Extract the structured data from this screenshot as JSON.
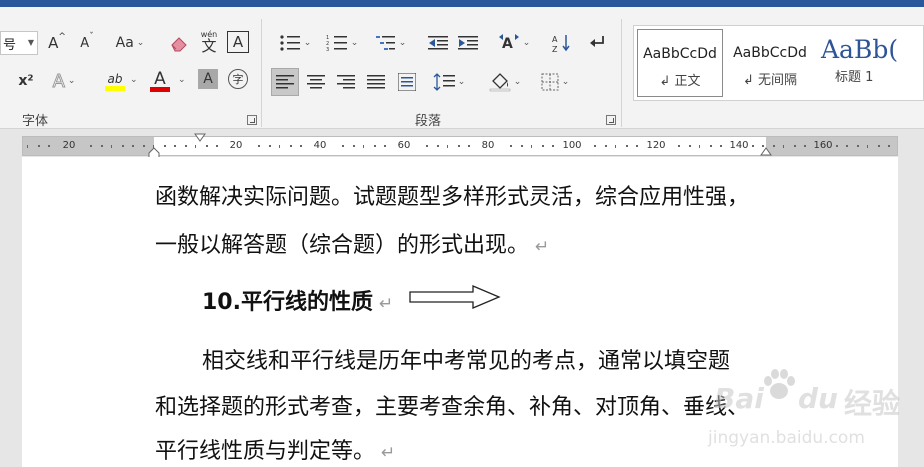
{
  "ribbon": {
    "font_group": {
      "label": "字体",
      "font_size_value": "号",
      "grow_font": "A",
      "shrink_font": "A",
      "change_case": "Aa",
      "phonetic_guide": "wén",
      "phonetic_char": "文",
      "char_border": "A",
      "superscript": "x²",
      "text_effects": "A",
      "highlight": "ab",
      "font_color": "A",
      "char_shading": "A",
      "enclose_char": "字"
    },
    "paragraph_group": {
      "label": "段落"
    },
    "styles_group": {
      "items": [
        {
          "sample": "AaBbCcDd",
          "name": "↲ 正文"
        },
        {
          "sample": "AaBbCcDd",
          "name": "↲ 无间隔"
        },
        {
          "sample": "AaBb(",
          "name": "标题 1"
        }
      ]
    },
    "colors": {
      "highlight_bar": "#ffff00",
      "font_color_bar": "#e00000",
      "title_band": "#2b579a"
    }
  },
  "ruler": {
    "labels": [
      "20",
      "20",
      "40",
      "60",
      "80",
      "100",
      "120",
      "140",
      "160"
    ]
  },
  "document": {
    "line1": "函数解决实际问题。试题题型多样形式灵活，综合应用性强，",
    "line2": "一般以解答题（综合题）的形式出现。",
    "heading": "10.平行线的性质",
    "line3": "相交线和平行线是历年中考常见的考点，通常以填空题",
    "line4": "和选择题的形式考查，主要考查余角、补角、对顶角、垂线、",
    "line5": "平行线性质与判定等。",
    "para_mark": "↵"
  },
  "watermark": {
    "brand": "Bai",
    "brand2": "du",
    "cn": "经验",
    "url": "jingyan.baidu.com"
  }
}
